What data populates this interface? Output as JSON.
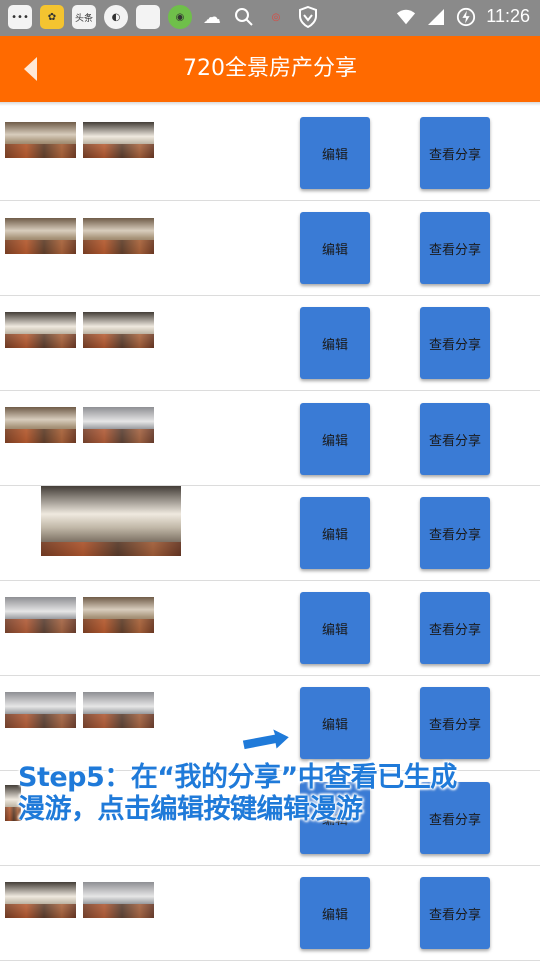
{
  "status_bar": {
    "time": "11:26",
    "left_icons": [
      "message-icon",
      "app-icon",
      "toutiao-icon",
      "browser-icon",
      "square-app-icon",
      "game-icon",
      "cloud-icon",
      "search-icon",
      "weibo-icon",
      "shield-icon"
    ],
    "toutiao_label": "头条",
    "right_icons": [
      "wifi-icon",
      "signal-icon",
      "battery-icon"
    ]
  },
  "header": {
    "title": "720全景房产分享",
    "accent_color": "#ff6a00"
  },
  "list": {
    "edit_label": "编辑",
    "view_label": "查看分享",
    "button_color": "#3a7bd5",
    "rows": [
      {
        "thumbs": 2
      },
      {
        "thumbs": 2
      },
      {
        "thumbs": 2
      },
      {
        "thumbs": 2
      },
      {
        "thumbs": 1
      },
      {
        "thumbs": 2
      },
      {
        "thumbs": 2
      },
      {
        "thumbs": 1
      },
      {
        "thumbs": 2
      }
    ]
  },
  "annotation": {
    "line1": "Step5：在“我的分享”中查看已生成",
    "line2": "漫游，点击编辑按键编辑漫游",
    "color": "#1f7ad9"
  }
}
